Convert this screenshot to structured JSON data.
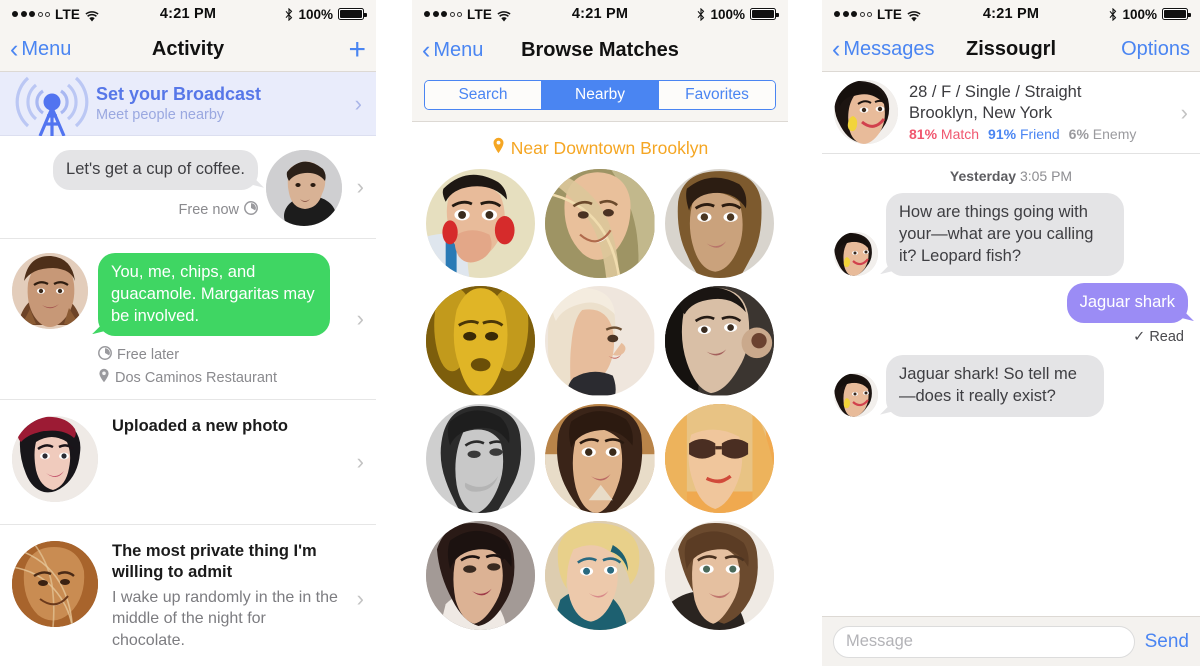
{
  "status_bar": {
    "carrier": "LTE",
    "time": "4:21 PM",
    "battery": "100%",
    "signal_filled": 3,
    "signal_hollow": 2
  },
  "phone1": {
    "nav": {
      "back_label": "Menu",
      "title": "Activity",
      "add_label": "+"
    },
    "broadcast": {
      "title": "Set your Broadcast",
      "subtitle": "Meet people nearby",
      "chevron": "›"
    },
    "rows": [
      {
        "type": "incoming_bubble",
        "bubble_text": "Let's get a cup of coffee.",
        "meta": [
          {
            "icon": "clock-icon",
            "text": "Free now",
            "icon_after": true
          }
        ],
        "chevron": "›"
      },
      {
        "type": "outgoing_bubble",
        "bubble_text": "You, me, chips, and guacamole. Margaritas may be involved.",
        "meta": [
          {
            "icon": "clock-icon",
            "text": "Free later"
          },
          {
            "icon": "location-pin-icon",
            "text": "Dos Caminos Restaurant"
          }
        ],
        "chevron": "›"
      },
      {
        "type": "activity",
        "title": "Uploaded a new photo",
        "body": "",
        "chevron": "›"
      },
      {
        "type": "activity",
        "title": "The most private thing I'm willing to admit",
        "body": "I wake up randomly in the in the middle of the night for chocolate.",
        "chevron": "›"
      }
    ]
  },
  "phone2": {
    "nav": {
      "back_label": "Menu",
      "title": "Browse Matches"
    },
    "segments": [
      {
        "label": "Search",
        "active": false
      },
      {
        "label": "Nearby",
        "active": true
      },
      {
        "label": "Favorites",
        "active": false
      }
    ],
    "location_header": {
      "icon": "location-pin-icon",
      "text": "Near Downtown Brooklyn"
    },
    "grid_count": 12
  },
  "phone3": {
    "nav": {
      "back_label": "Messages",
      "title": "Zissougrl",
      "right_label": "Options"
    },
    "profile": {
      "line1": "28 / F / Single / Straight",
      "line2": "Brooklyn, New York",
      "match": "81%",
      "match_label": "Match",
      "friend": "91%",
      "friend_label": "Friend",
      "enemy": "6%",
      "enemy_label": "Enemy",
      "chevron": "›"
    },
    "daystamp": {
      "day": "Yesterday",
      "time": "3:05 PM"
    },
    "messages": [
      {
        "dir": "in",
        "text": "How are things going with your—what are you calling it? Leopard fish?"
      },
      {
        "dir": "out",
        "text": "Jaguar shark",
        "receipt": "✓ Read"
      },
      {
        "dir": "in",
        "text": "Jaguar shark! So tell me —does it really exist?"
      }
    ],
    "composer": {
      "placeholder": "Message",
      "value": "",
      "send_label": "Send"
    }
  },
  "colors": {
    "tint_blue": "#4a85f2",
    "bubble_green": "#3fd663",
    "bubble_grey": "#e4e4e6",
    "bubble_purple": "#9b8cf5",
    "accent_orange": "#f5a623",
    "match_pink": "#f0576f",
    "broadcast_bg": "#e9ecfb",
    "chrome_bg": "#f7f5f2"
  }
}
